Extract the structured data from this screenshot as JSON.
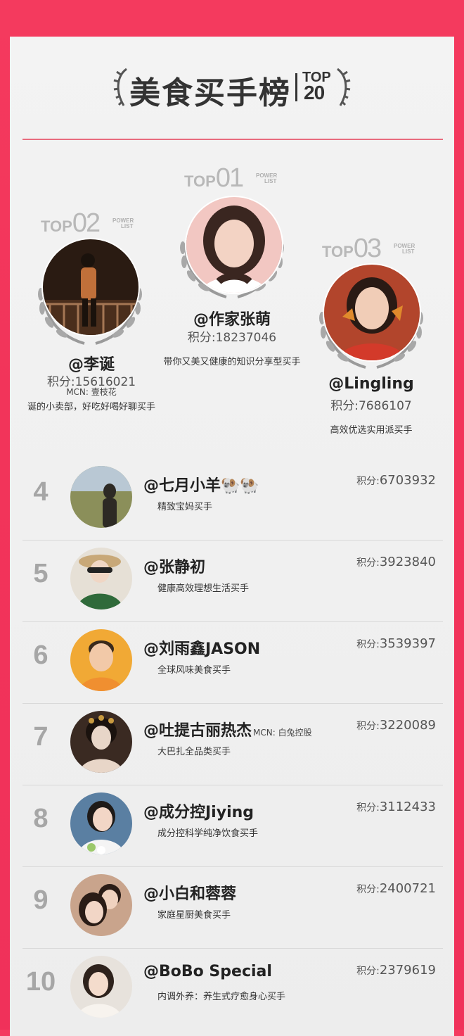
{
  "header": {
    "title": "美食买手榜",
    "top_word": "TOP",
    "top_num": "20"
  },
  "podium": [
    {
      "label_top": "TOP",
      "label_num": "01",
      "label_power": "POWER",
      "label_list": "LIST",
      "name": "@作家张萌",
      "score": "积分:18237046",
      "desc": "带你又美又健康的知识分享型买手",
      "colors": {
        "bg": "#f2c7c2",
        "hair": "#3a2620",
        "skin": "#f3d3c4"
      }
    },
    {
      "label_top": "TOP",
      "label_num": "02",
      "label_power": "POWER",
      "label_list": "LIST",
      "name": "@李诞",
      "score": "积分:15616021",
      "mcn": "MCN: 壹枝花",
      "desc": "诞的小卖部，好吃好喝好聊买手",
      "colors": {
        "bg": "#2a1b12",
        "hair": "#1a120c",
        "skin": "#c0703a"
      }
    },
    {
      "label_top": "TOP",
      "label_num": "03",
      "label_power": "POWER",
      "label_list": "LIST",
      "name": "@Lingling",
      "score": "积分:7686107",
      "desc": "高效优选实用派买手",
      "colors": {
        "bg": "#b2452c",
        "hair": "#2a1a14",
        "skin": "#f1cdb7"
      }
    }
  ],
  "list": [
    {
      "rank": "4",
      "name": "@七月小羊🐏🐏",
      "score_key": "积分:",
      "score": "6703932",
      "desc": "精致宝妈买手",
      "avatar_bg": "#8b8f5a",
      "avatar_fg": "#2d2a24"
    },
    {
      "rank": "5",
      "name": "@张静初",
      "score_key": "积分:",
      "score": "3923840",
      "desc": "健康高效理想生活买手",
      "avatar_bg": "#e6e0d6",
      "avatar_fg": "#2f6a3a"
    },
    {
      "rank": "6",
      "name": "@刘雨鑫JASON",
      "score_key": "积分:",
      "score": "3539397",
      "desc": "全球风味美食买手",
      "avatar_bg": "#f1a935",
      "avatar_fg": "#3a2a1c"
    },
    {
      "rank": "7",
      "name": "@吐提古丽热杰",
      "mcn": "MCN: 白兔控股",
      "score_key": "积分:",
      "score": "3220089",
      "desc": "大巴扎全品类买手",
      "avatar_bg": "#3a2a22",
      "avatar_fg": "#e8d6c8"
    },
    {
      "rank": "8",
      "name": "@成分控Jiying",
      "score_key": "积分:",
      "score": "3112433",
      "desc": "成分控科学纯净饮食买手",
      "avatar_bg": "#5a7fa2",
      "avatar_fg": "#f4f4f4"
    },
    {
      "rank": "9",
      "name": "@小白和蓉蓉",
      "score_key": "积分:",
      "score": "2400721",
      "desc": "家庭星厨美食买手",
      "avatar_bg": "#c9a48c",
      "avatar_fg": "#2a1c16"
    },
    {
      "rank": "10",
      "name": "@BoBo Special",
      "score_key": "积分:",
      "score": "2379619",
      "desc": "内调外养：养生式疗愈身心买手",
      "avatar_bg": "#e7e2dc",
      "avatar_fg": "#2e221c"
    }
  ]
}
